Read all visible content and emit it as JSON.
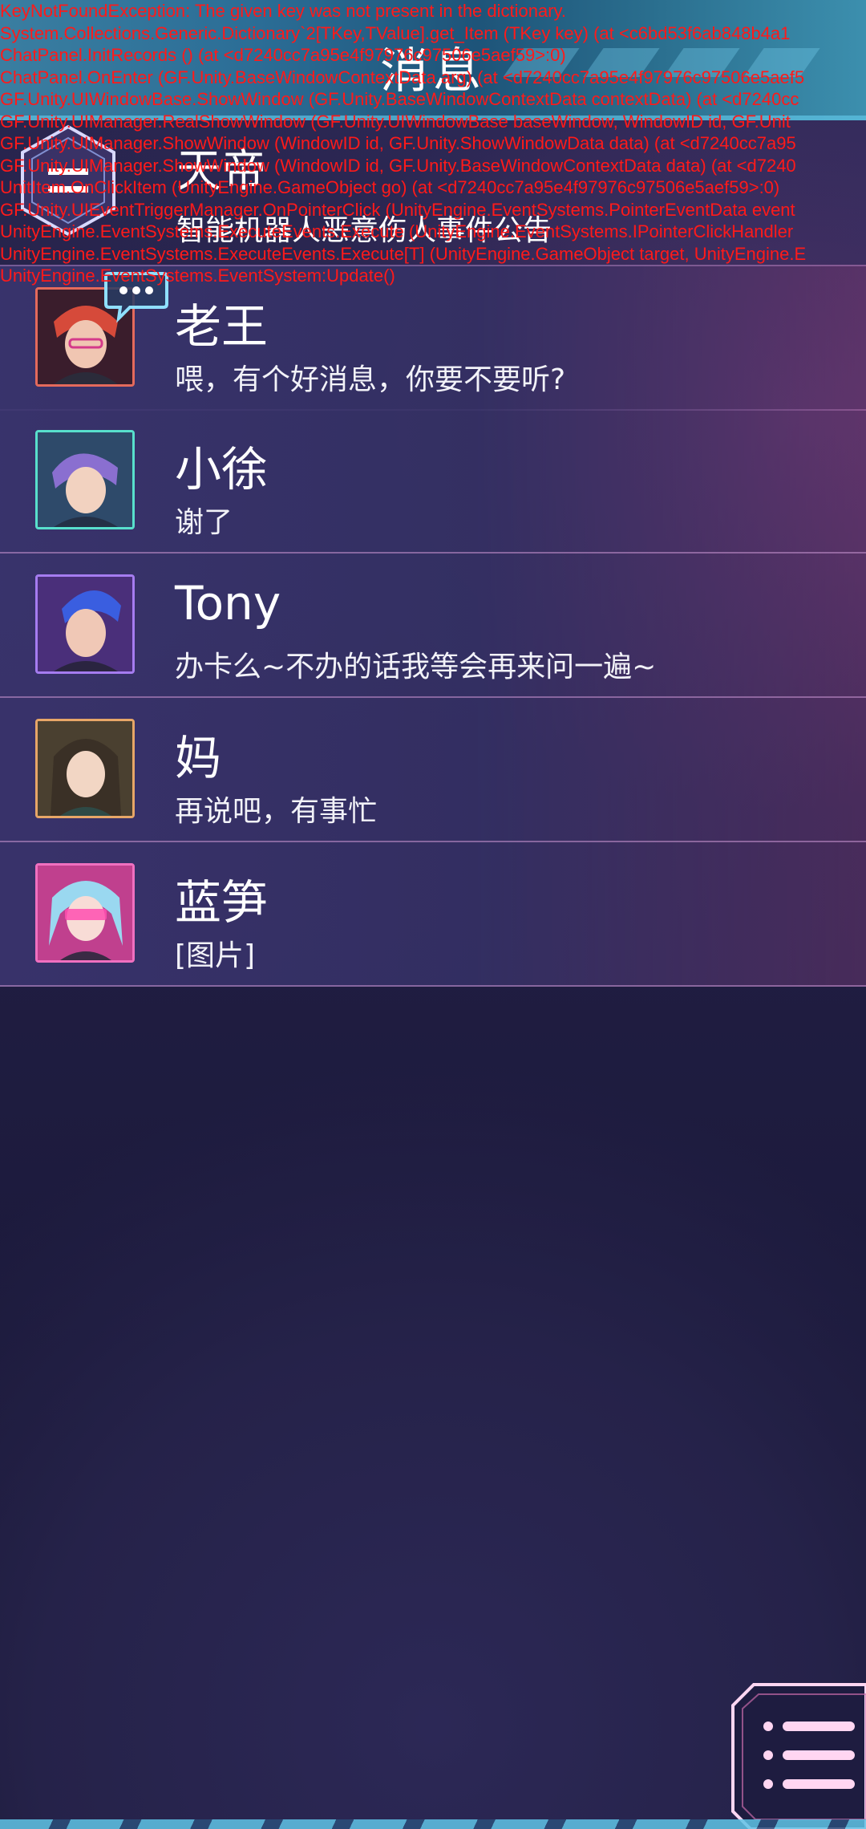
{
  "header": {
    "title": "消息"
  },
  "announcement": {
    "name": "天帝",
    "text": "智能机器人恶意伤人事件公告"
  },
  "contacts": [
    {
      "name": "老王",
      "message": "喂，有个好消息，你要不要听?",
      "frame_color": "#e46a5c",
      "avatar_bg": "#6a2d3a",
      "hair": "#d64a3a",
      "has_chat_badge": true
    },
    {
      "name": "小徐",
      "message": "谢了",
      "frame_color": "#58e0cc",
      "avatar_bg": "#2d4f6a",
      "hair": "#8a6fd0",
      "has_chat_badge": false
    },
    {
      "name": "Tony",
      "message": "办卡么~不办的话我等会再来问一遍~",
      "frame_color": "#a57cf0",
      "avatar_bg": "#3a2f6a",
      "hair": "#3a5ee0",
      "has_chat_badge": false
    },
    {
      "name": "妈",
      "message": "再说吧，有事忙",
      "frame_color": "#e7a667",
      "avatar_bg": "#5a4632",
      "hair": "#3a3026",
      "has_chat_badge": false
    },
    {
      "name": "蓝笋",
      "message": "[图片]",
      "frame_color": "#f070c0",
      "avatar_bg": "#8a2f6a",
      "hair": "#9ad8f0",
      "has_chat_badge": false
    }
  ],
  "error_log": "KeyNotFoundException: The given key was not present in the dictionary.\nSystem.Collections.Generic.Dictionary`2[TKey,TValue].get_Item (TKey key) (at <c6bd53f6ab848b4a1\nChatPanel.InitRecords () (at <d7240cc7a95e4f97976c97506e5aef59>:0)\nChatPanel.OnEnter (GF.Unity.BaseWindowContextData arg) (at <d7240cc7a95e4f97976c97506e5aef5\nGF.Unity.UIWindowBase.ShowWindow (GF.Unity.BaseWindowContextData contextData) (at <d7240cc\nGF.Unity.UIManager.RealShowWindow (GF.Unity.UIWindowBase baseWindow, WindowID id, GF.Unit\nGF.Unity.UIManager.ShowWindow (WindowID id, GF.Unity.ShowWindowData data) (at <d7240cc7a95\nGF.Unity.UIManager.ShowWindow (WindowID id, GF.Unity.BaseWindowContextData data) (at <d7240\nUnitItem.OnClickItem (UnityEngine.GameObject go) (at <d7240cc7a95e4f97976c97506e5aef59>:0)\nGF.Unity.UIEventTriggerManager.OnPointerClick (UnityEngine.EventSystems.PointerEventData event\nUnityEngine.EventSystems.ExecuteEvents.Execute (UnityEngine.EventSystems.IPointerClickHandler\nUnityEngine.EventSystems.ExecuteEvents.Execute[T] (UnityEngine.GameObject target, UnityEngine.E\nUnityEngine.EventSystems.EventSystem:Update()",
  "colors": {
    "error_text": "#ff1a1a",
    "header_accent": "#5fc4e6",
    "menu_accent": "#ffd6f2"
  }
}
